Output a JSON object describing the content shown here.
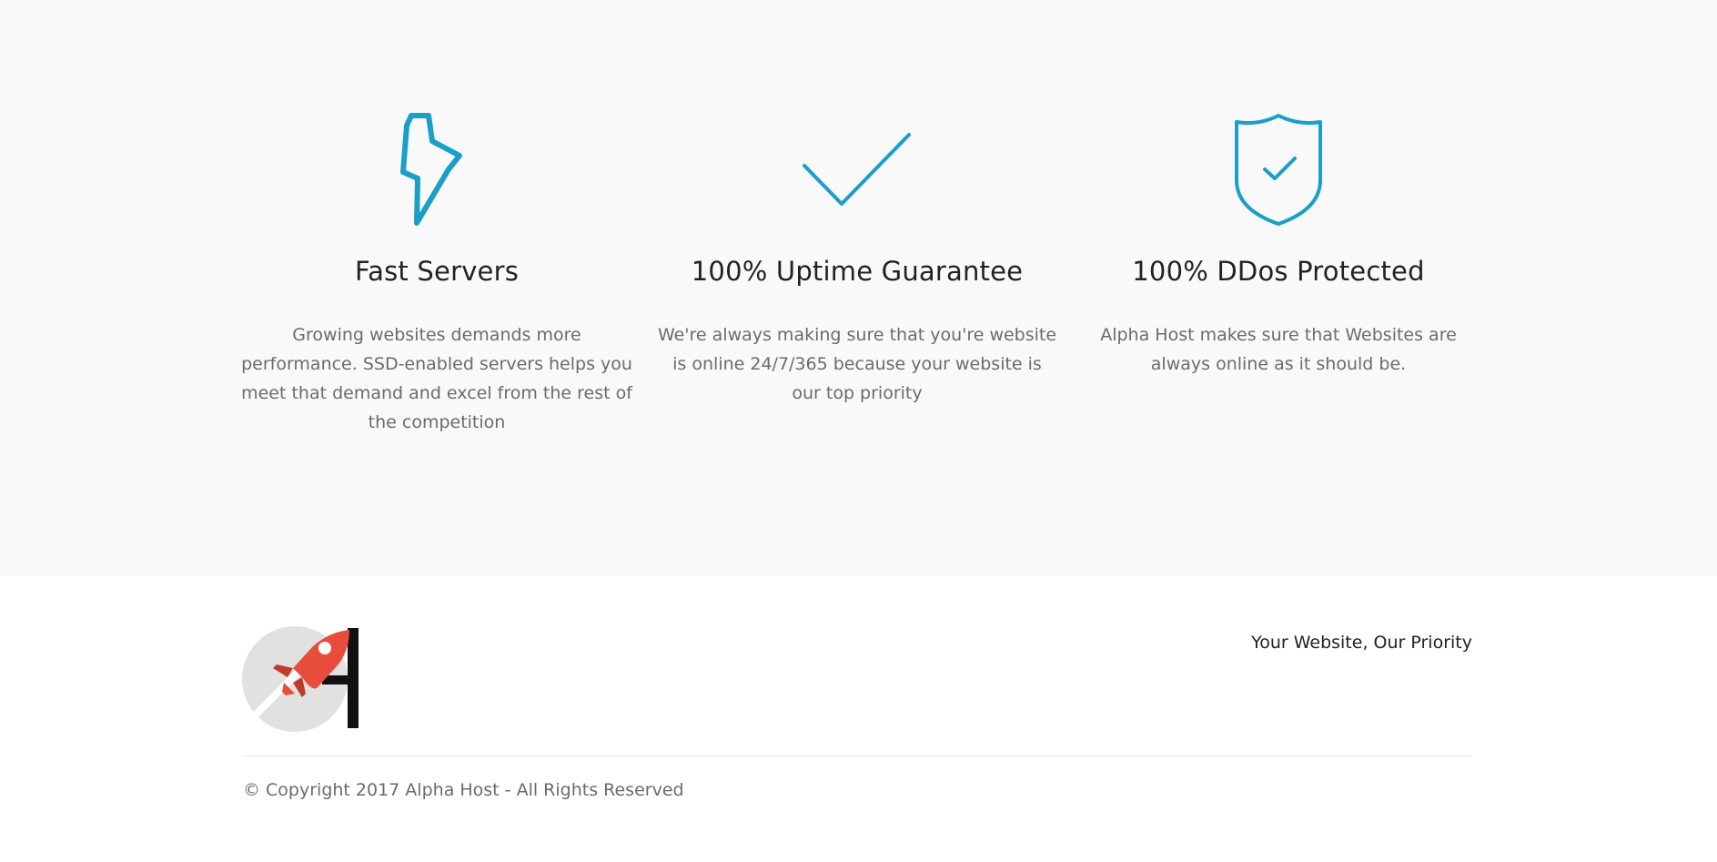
{
  "features": [
    {
      "icon": "lightning-bolt-icon",
      "title": "Fast Servers",
      "description": "Growing websites demands more performance. SSD-enabled servers helps you meet that demand and excel from the rest of the competition"
    },
    {
      "icon": "checkmark-icon",
      "title": "100% Uptime Guarantee",
      "description": "We're always making sure that you're website is online 24/7/365 because your website is our top priority"
    },
    {
      "icon": "shield-check-icon",
      "title": "100% DDos Protected",
      "description": "Alpha Host makes sure that Websites are always online as it should be."
    }
  ],
  "footer": {
    "logo": "alpha-host-rocket-logo",
    "tagline": "Your Website, Our Priority",
    "copyright": "© Copyright 2017 Alpha Host - All Rights Reserved"
  },
  "colors": {
    "accent": "#1a9fc9",
    "feature_bg": "#f9f9f9",
    "heading": "#222222",
    "body_text": "#6b6b6b",
    "logo_red": "#e84c3d",
    "logo_gray": "#e1e1e1"
  }
}
